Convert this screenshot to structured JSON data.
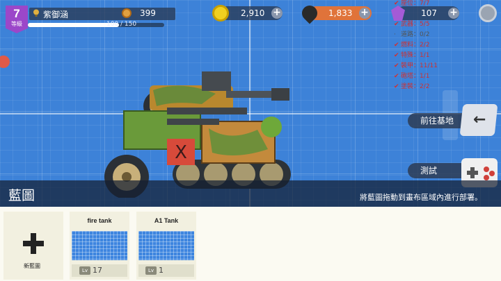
{
  "hud": {
    "level": "7",
    "level_label": "等級",
    "player_name": "紫御涵",
    "medals": "399",
    "xp_text": "100 / 150",
    "xp_fraction": 0.667,
    "coins": "2,910",
    "oil": "1,833",
    "gems": "107"
  },
  "stats": [
    {
      "mark": "✔",
      "text": "座位：7/7",
      "color": "#d03030"
    },
    {
      "mark": "✔",
      "text": "武器：5/5",
      "color": "#d03030"
    },
    {
      "mark": "·",
      "text": "道路：0/2",
      "color": "#555555"
    },
    {
      "mark": "✔",
      "text": "燃料：2/2",
      "color": "#d03030"
    },
    {
      "mark": "✔",
      "text": "特殊：1/1",
      "color": "#d03030"
    },
    {
      "mark": "✔",
      "text": "裝甲：11/11",
      "color": "#d03030"
    },
    {
      "mark": "✔",
      "text": "砲塔：1/1",
      "color": "#d03030"
    },
    {
      "mark": "✔",
      "text": "塗裝：2/2",
      "color": "#d03030"
    }
  ],
  "buttons": {
    "go_base": "前往基地",
    "test": "測試"
  },
  "banner": {
    "title": "藍圖",
    "hint": "將藍圖拖動到畫布區域內進行部署。"
  },
  "tray": {
    "new_label": "新藍圖",
    "blueprints": [
      {
        "name": "fire tank",
        "lv_tag": "Lv",
        "level": "17"
      },
      {
        "name": "A1 Tank",
        "lv_tag": "Lv",
        "level": "1"
      }
    ]
  }
}
